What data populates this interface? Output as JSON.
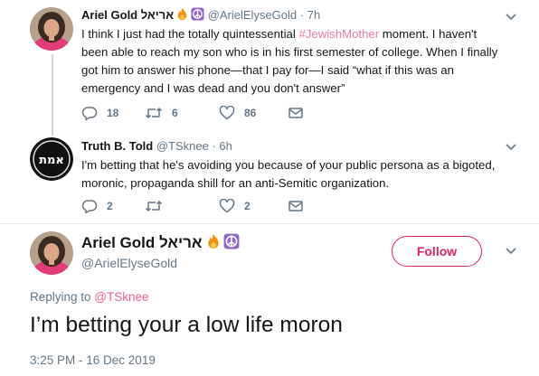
{
  "tweet1": {
    "name": "Ariel Gold אריאל",
    "handle": "@ArielElyseGold",
    "separator": "·",
    "time": "7h",
    "text_before": "I think I just had the totally quintessential ",
    "hashtag": "#JewishMother",
    "text_after": " moment. I haven't been able to reach my son who is in his first semester of college. When I finally got him to answer his phone—that I pay for—I said “what if this was an emergency and I was dead and you don't answer”",
    "replies": "18",
    "retweets": "6",
    "likes": "86"
  },
  "tweet2": {
    "name": "Truth B. Told",
    "handle": "@TSknee",
    "separator": "·",
    "time": "6h",
    "avatar_text": "אמת",
    "text": "I'm betting that he's avoiding you because of your public persona as a bigoted, moronic, propaganda shill for an anti-Semitic organization.",
    "replies": "2",
    "retweets": "",
    "likes": "2"
  },
  "main": {
    "name": "Ariel Gold אריאל",
    "handle": "@ArielElyseGold",
    "follow_label": "Follow",
    "replying_prefix": "Replying to ",
    "replying_to": "@TSknee",
    "text": "I’m betting your a low life moron",
    "timestamp": "3:25 PM - 16 Dec 2019"
  },
  "colors": {
    "accent": "#e0245e",
    "muted": "#657786",
    "text": "#14171a",
    "divider": "#e6ecf0"
  },
  "icons": [
    "fire-icon",
    "peace-icon",
    "reply-icon",
    "retweet-icon",
    "like-icon",
    "message-icon",
    "chevron-down-icon"
  ]
}
